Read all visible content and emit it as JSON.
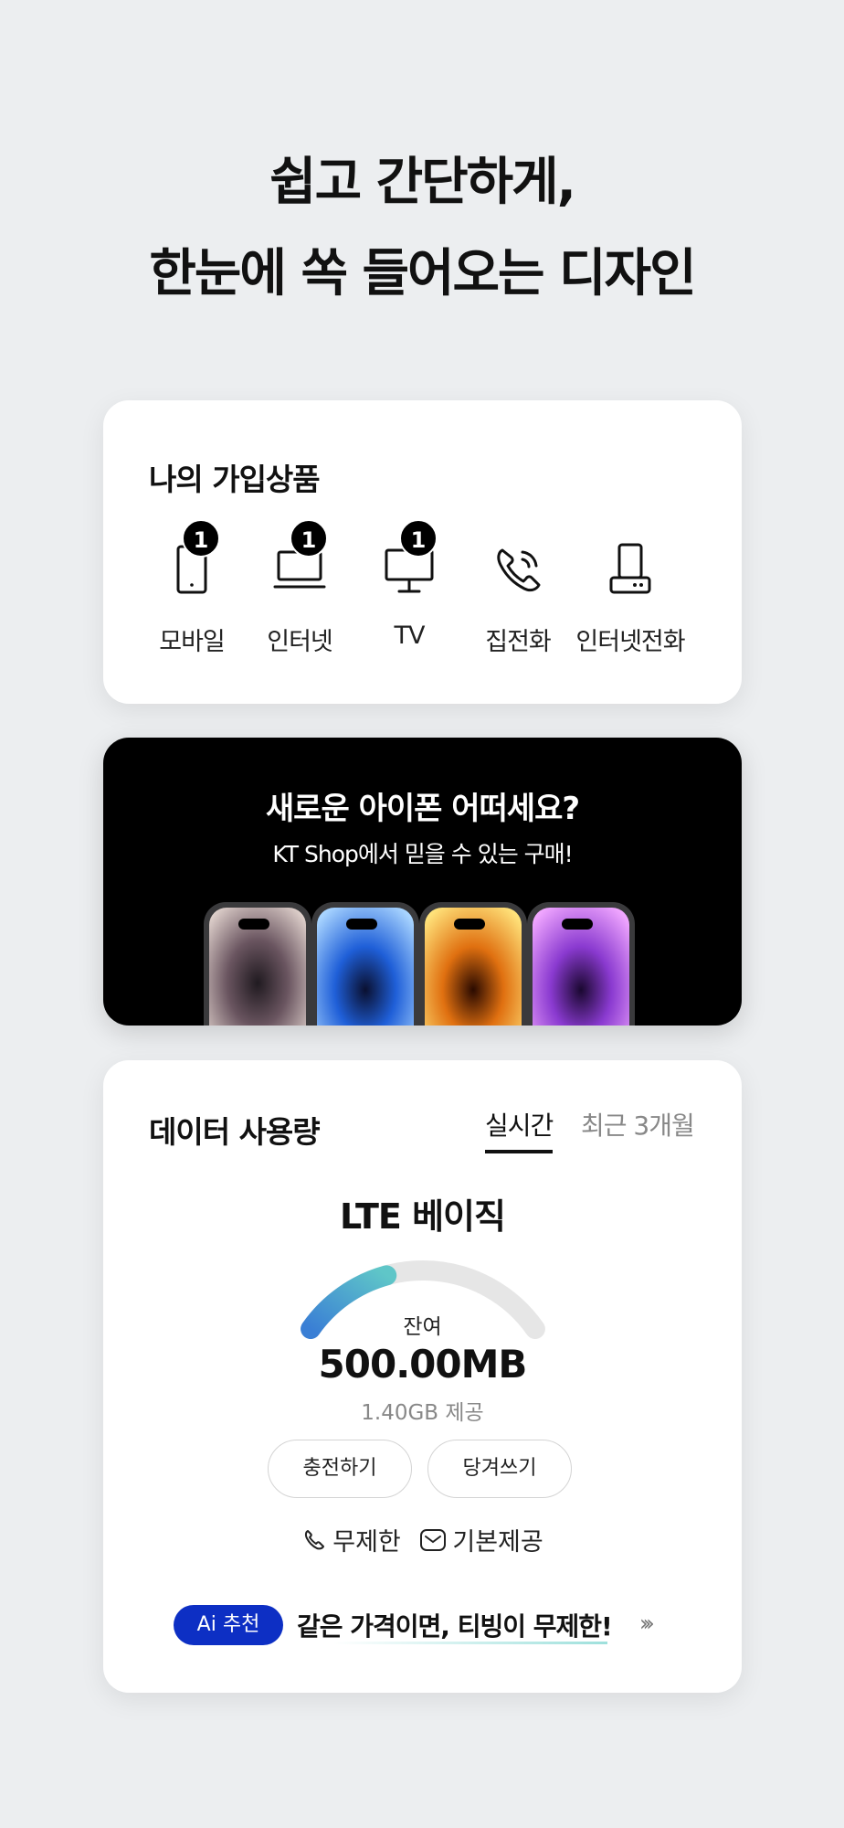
{
  "headline": {
    "line1": "쉽고 간단하게,",
    "line2": "한눈에 쏙 들어오는 디자인"
  },
  "products": {
    "title": "나의 가입상품",
    "items": [
      {
        "label": "모바일",
        "icon": "tablet-icon",
        "badge": "1"
      },
      {
        "label": "인터넷",
        "icon": "laptop-icon",
        "badge": "1"
      },
      {
        "label": "TV",
        "icon": "monitor-icon",
        "badge": "1"
      },
      {
        "label": "집전화",
        "icon": "phone-call-icon",
        "badge": null
      },
      {
        "label": "인터넷전화",
        "icon": "desk-phone-icon",
        "badge": null
      }
    ]
  },
  "banner": {
    "title": "새로운 아이폰 어떠세요?",
    "subtitle": "KT Shop에서 믿을 수 있는 구매!",
    "phone_colors": [
      "#d9c9c4",
      "#2a6fe0",
      "#f0a020",
      "#b24fd6"
    ]
  },
  "data_usage": {
    "title": "데이터 사용량",
    "tabs": [
      {
        "label": "실시간",
        "active": true
      },
      {
        "label": "최근 3개월",
        "active": false
      }
    ],
    "plan": "LTE 베이직",
    "remaining_label": "잔여",
    "remaining_value": "500.00MB",
    "provided": "1.40GB 제공",
    "remaining_fraction": 0.36,
    "buttons": {
      "charge": "충전하기",
      "pull": "당겨쓰기"
    },
    "features": [
      {
        "icon": "phone-icon",
        "label": "무제한"
      },
      {
        "icon": "message-icon",
        "label": "기본제공"
      }
    ],
    "ai": {
      "badge": "Ai 추천",
      "text": "같은 가격이면, 티빙이 무제한!",
      "arrow": "›››"
    },
    "colors": {
      "gauge_start": "#3a7fd5",
      "gauge_end": "#5fc6c8",
      "ai_badge": "#0d2fc4"
    }
  }
}
